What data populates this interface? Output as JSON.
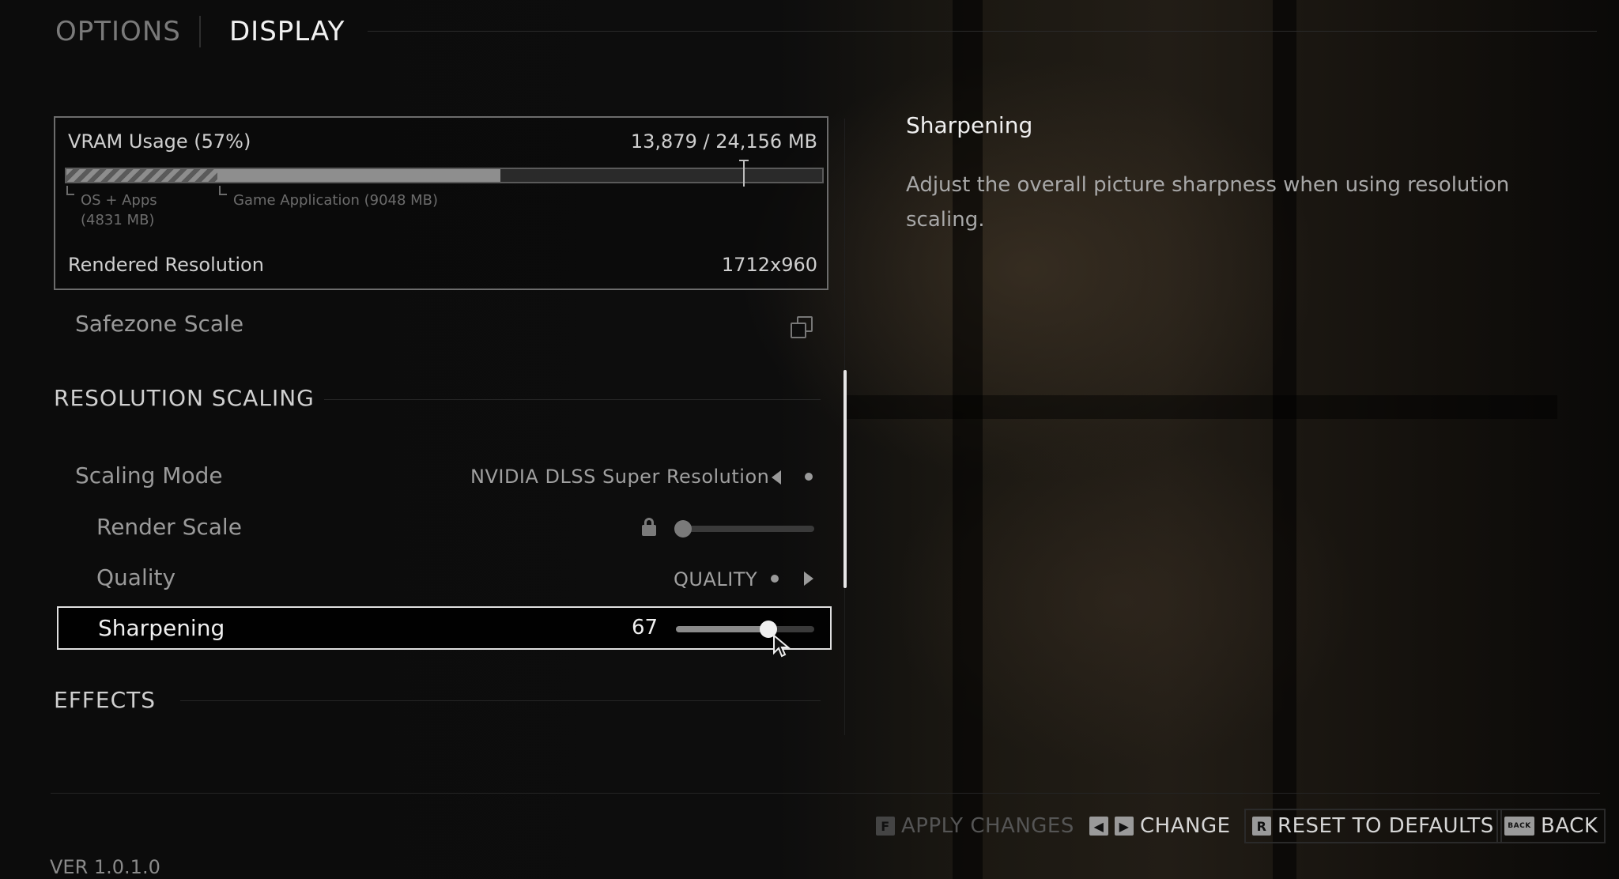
{
  "header": {
    "tabs": [
      {
        "label": "OPTIONS"
      },
      {
        "label": "DISPLAY"
      }
    ]
  },
  "vram": {
    "label": "VRAM Usage (57%)",
    "value": "13,879 / 24,156 MB",
    "usage_percent": 57,
    "os_apps_mb": 4831,
    "game_mb": 9048,
    "total_mb": 24156,
    "os_label_line1": "OS + Apps",
    "os_label_line2": "(4831 MB)",
    "game_label": "Game Application (9048 MB)",
    "rendered_resolution_label": "Rendered Resolution",
    "rendered_resolution_value": "1712x960"
  },
  "settings": {
    "safezone": {
      "label": "Safezone Scale"
    },
    "resolution_scaling": {
      "title": "RESOLUTION SCALING"
    },
    "scaling_mode": {
      "label": "Scaling Mode",
      "value": "NVIDIA DLSS Super Resolution"
    },
    "render_scale": {
      "label": "Render Scale",
      "level": 0
    },
    "quality": {
      "label": "Quality",
      "value": "QUALITY"
    },
    "sharpening": {
      "label": "Sharpening",
      "value": "67",
      "level": 0.67
    },
    "effects": {
      "title": "EFFECTS"
    }
  },
  "description": {
    "title": "Sharpening",
    "text": "Adjust the overall picture sharpness when using resolution scaling."
  },
  "footer": {
    "apply": {
      "key": "F",
      "label": "APPLY CHANGES"
    },
    "change": {
      "label": "CHANGE"
    },
    "reset": {
      "key": "R",
      "label": "RESET TO DEFAULTS"
    },
    "back": {
      "key": "BACK",
      "label": "BACK"
    },
    "version": "VER 1.0.1.0"
  }
}
